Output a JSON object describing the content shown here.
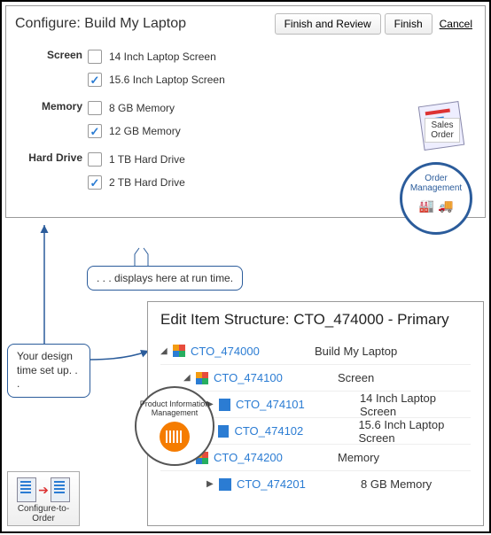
{
  "configure": {
    "title": "Configure: Build My Laptop",
    "buttons": {
      "finish_review": "Finish and Review",
      "finish": "Finish",
      "cancel": "Cancel"
    },
    "groups": [
      {
        "label": "Screen",
        "options": [
          {
            "label": "14 Inch Laptop Screen",
            "checked": false
          },
          {
            "label": "15.6 Inch Laptop Screen",
            "checked": true
          }
        ]
      },
      {
        "label": "Memory",
        "options": [
          {
            "label": "8 GB Memory",
            "checked": false
          },
          {
            "label": "12 GB Memory",
            "checked": true
          }
        ]
      },
      {
        "label": "Hard Drive",
        "options": [
          {
            "label": "1 TB Hard Drive",
            "checked": false
          },
          {
            "label": "2 TB Hard Drive",
            "checked": true
          }
        ]
      }
    ]
  },
  "badges": {
    "sales_order": "Sales Order",
    "order_management": "Order Management",
    "pim": "Product Information Management",
    "cto": "Configure-to-Order"
  },
  "callouts": {
    "runtime": ". . . displays here at run time.",
    "design": "Your design time set up. . ."
  },
  "edit": {
    "title": "Edit Item Structure: CTO_474000 - Primary",
    "rows": [
      {
        "indent": 0,
        "toggle": "expanded",
        "icon": "multi",
        "code": "CTO_474000",
        "desc": "Build My Laptop"
      },
      {
        "indent": 1,
        "toggle": "expanded",
        "icon": "multi",
        "code": "CTO_474100",
        "desc": "Screen"
      },
      {
        "indent": 2,
        "toggle": "collapsed",
        "icon": "single",
        "code": "CTO_474101",
        "desc": "14 Inch Laptop Screen"
      },
      {
        "indent": 2,
        "toggle": "collapsed",
        "icon": "single",
        "code": "CTO_474102",
        "desc": "15.6 Inch Laptop Screen"
      },
      {
        "indent": 1,
        "toggle": "expanded",
        "icon": "multi",
        "code": "CTO_474200",
        "desc": "Memory"
      },
      {
        "indent": 2,
        "toggle": "collapsed",
        "icon": "single",
        "code": "CTO_474201",
        "desc": "8 GB Memory"
      }
    ]
  }
}
